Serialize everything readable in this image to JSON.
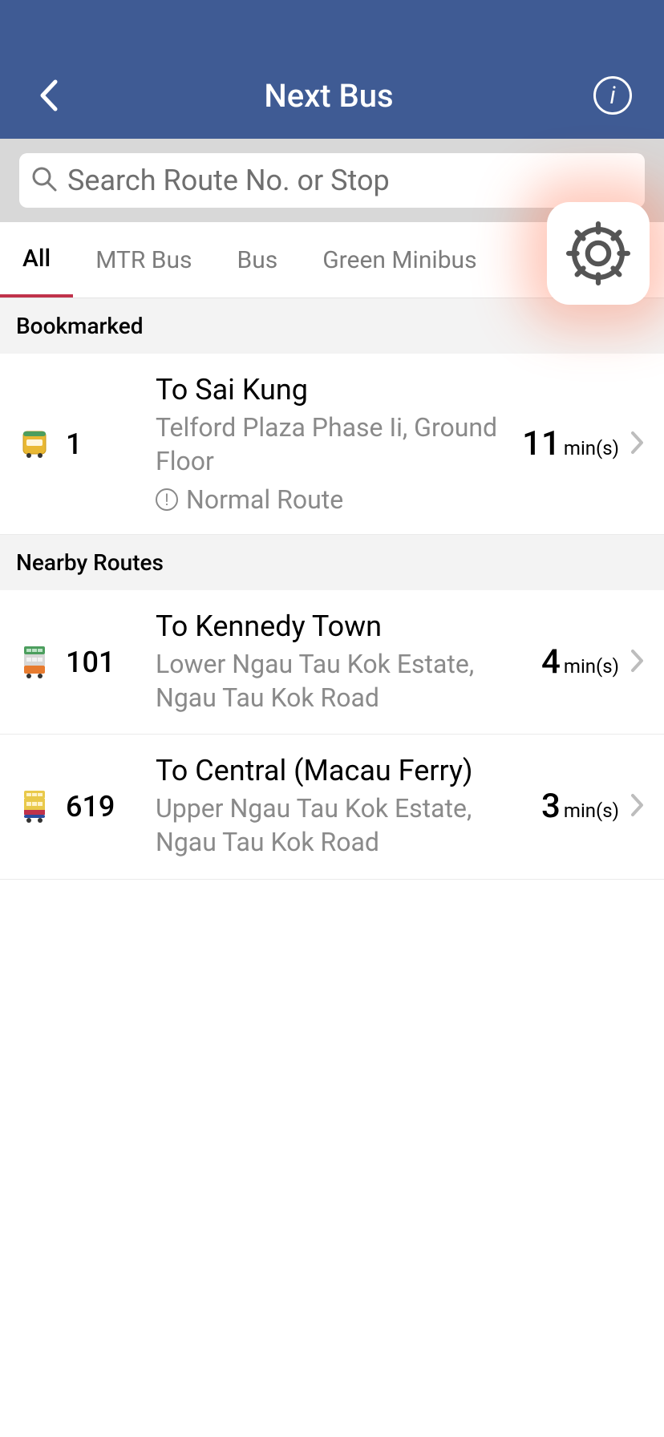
{
  "header": {
    "title": "Next Bus"
  },
  "search": {
    "placeholder": "Search Route No. or Stop"
  },
  "tabs": [
    {
      "label": "All",
      "active": true
    },
    {
      "label": "MTR Bus",
      "active": false
    },
    {
      "label": "Bus",
      "active": false
    },
    {
      "label": "Green Minibus",
      "active": false
    }
  ],
  "sections": {
    "bookmarked": {
      "title": "Bookmarked",
      "routes": [
        {
          "icon": "minibus",
          "number": "1",
          "destination": "To Sai Kung",
          "stop": "Telford Plaza Phase Ii, Ground Floor",
          "status": "Normal Route",
          "eta": "11",
          "unit": "min(s)"
        }
      ]
    },
    "nearby": {
      "title": "Nearby Routes",
      "routes": [
        {
          "icon": "bus-a",
          "number": "101",
          "destination": "To Kennedy Town",
          "stop": "Lower Ngau Tau Kok Estate, Ngau Tau Kok Road",
          "eta": "4",
          "unit": "min(s)"
        },
        {
          "icon": "bus-b",
          "number": "619",
          "destination": "To Central (Macau Ferry)",
          "stop": "Upper Ngau Tau Kok Estate, Ngau Tau Kok Road",
          "eta": "3",
          "unit": "min(s)"
        }
      ]
    }
  }
}
